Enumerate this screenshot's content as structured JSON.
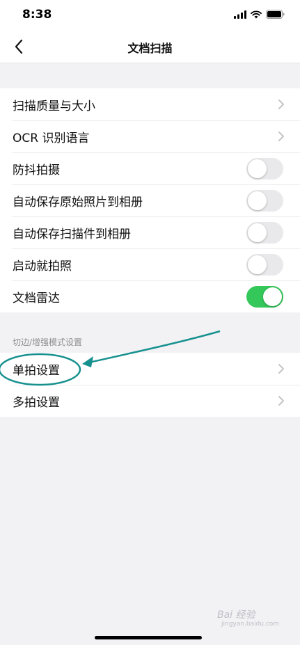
{
  "status_bar": {
    "time": "8:38"
  },
  "nav": {
    "title": "文档扫描"
  },
  "settings": [
    {
      "label": "扫描质量与大小",
      "control": "chevron"
    },
    {
      "label": "OCR 识别语言",
      "control": "chevron"
    },
    {
      "label": "防抖拍摄",
      "control": "toggle",
      "on": false
    },
    {
      "label": "自动保存原始照片到相册",
      "control": "toggle",
      "on": false
    },
    {
      "label": "自动保存扫描件到相册",
      "control": "toggle",
      "on": false
    },
    {
      "label": "启动就拍照",
      "control": "toggle",
      "on": false
    },
    {
      "label": "文档雷达",
      "control": "toggle",
      "on": true
    }
  ],
  "section2": {
    "header": "切边/增强模式设置",
    "items": [
      {
        "label": "单拍设置"
      },
      {
        "label": "多拍设置"
      }
    ]
  },
  "colors": {
    "accent_green": "#34c759",
    "annotation_teal": "#17918f"
  },
  "watermark": {
    "text": "Bai 经验",
    "sub": "jingyan.baidu.com"
  }
}
